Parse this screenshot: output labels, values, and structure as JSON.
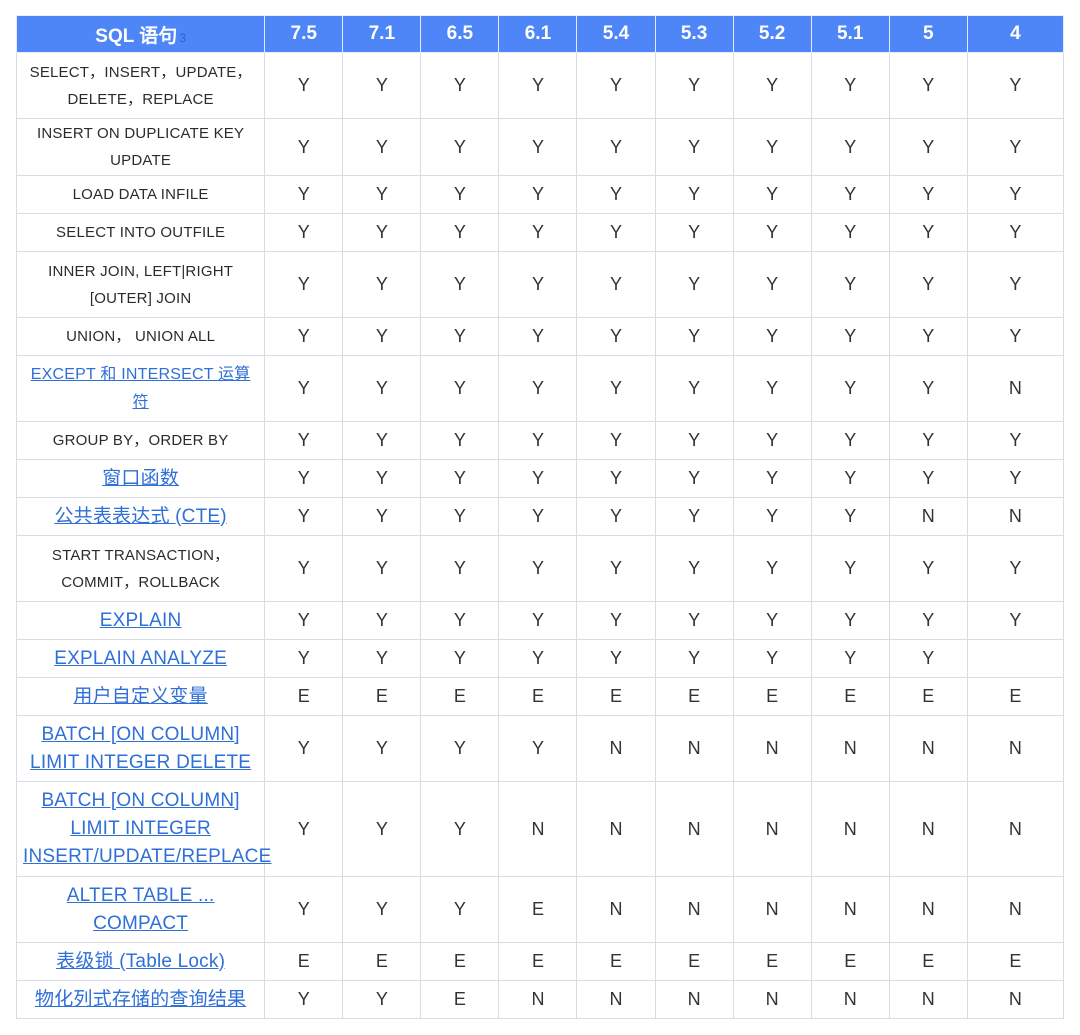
{
  "header": {
    "feature_col": "SQL 语句",
    "feature_col_note": "3",
    "versions": [
      "7.5",
      "7.1",
      "6.5",
      "6.1",
      "5.4",
      "5.3",
      "5.2",
      "5.1",
      "5",
      "4"
    ]
  },
  "rows": [
    {
      "label": "SELECT，INSERT，UPDATE，DELETE，REPLACE",
      "link": false,
      "values": [
        "Y",
        "Y",
        "Y",
        "Y",
        "Y",
        "Y",
        "Y",
        "Y",
        "Y",
        "Y"
      ]
    },
    {
      "label": "INSERT ON DUPLICATE KEY UPDATE",
      "link": false,
      "values": [
        "Y",
        "Y",
        "Y",
        "Y",
        "Y",
        "Y",
        "Y",
        "Y",
        "Y",
        "Y"
      ]
    },
    {
      "label": "LOAD DATA INFILE",
      "link": false,
      "values": [
        "Y",
        "Y",
        "Y",
        "Y",
        "Y",
        "Y",
        "Y",
        "Y",
        "Y",
        "Y"
      ]
    },
    {
      "label": "SELECT INTO OUTFILE",
      "link": false,
      "values": [
        "Y",
        "Y",
        "Y",
        "Y",
        "Y",
        "Y",
        "Y",
        "Y",
        "Y",
        "Y"
      ]
    },
    {
      "label": "INNER JOIN, LEFT|RIGHT [OUTER] JOIN",
      "link": false,
      "values": [
        "Y",
        "Y",
        "Y",
        "Y",
        "Y",
        "Y",
        "Y",
        "Y",
        "Y",
        "Y"
      ]
    },
    {
      "label": "UNION， UNION ALL",
      "link": false,
      "values": [
        "Y",
        "Y",
        "Y",
        "Y",
        "Y",
        "Y",
        "Y",
        "Y",
        "Y",
        "Y"
      ]
    },
    {
      "label": "EXCEPT 和 INTERSECT 运算符",
      "link": true,
      "small": true,
      "values": [
        "Y",
        "Y",
        "Y",
        "Y",
        "Y",
        "Y",
        "Y",
        "Y",
        "Y",
        "N"
      ]
    },
    {
      "label": "GROUP BY，ORDER BY",
      "link": false,
      "values": [
        "Y",
        "Y",
        "Y",
        "Y",
        "Y",
        "Y",
        "Y",
        "Y",
        "Y",
        "Y"
      ]
    },
    {
      "label": "窗口函数",
      "link": true,
      "values": [
        "Y",
        "Y",
        "Y",
        "Y",
        "Y",
        "Y",
        "Y",
        "Y",
        "Y",
        "Y"
      ]
    },
    {
      "label": "公共表表达式 (CTE)",
      "link": true,
      "values": [
        "Y",
        "Y",
        "Y",
        "Y",
        "Y",
        "Y",
        "Y",
        "Y",
        "N",
        "N"
      ]
    },
    {
      "label": "START TRANSACTION，COMMIT，ROLLBACK",
      "link": false,
      "values": [
        "Y",
        "Y",
        "Y",
        "Y",
        "Y",
        "Y",
        "Y",
        "Y",
        "Y",
        "Y"
      ]
    },
    {
      "label": "EXPLAIN",
      "link": true,
      "values": [
        "Y",
        "Y",
        "Y",
        "Y",
        "Y",
        "Y",
        "Y",
        "Y",
        "Y",
        "Y"
      ]
    },
    {
      "label": "EXPLAIN ANALYZE",
      "link": true,
      "values": [
        "Y",
        "Y",
        "Y",
        "Y",
        "Y",
        "Y",
        "Y",
        "Y",
        "Y",
        ""
      ]
    },
    {
      "label": "用户自定义变量",
      "link": true,
      "values": [
        "E",
        "E",
        "E",
        "E",
        "E",
        "E",
        "E",
        "E",
        "E",
        "E"
      ]
    },
    {
      "label": "BATCH [ON COLUMN] LIMIT INTEGER DELETE",
      "link": true,
      "values": [
        "Y",
        "Y",
        "Y",
        "Y",
        "N",
        "N",
        "N",
        "N",
        "N",
        "N"
      ]
    },
    {
      "label": "BATCH [ON COLUMN] LIMIT INTEGER INSERT/UPDATE/REPLACE",
      "link": true,
      "values": [
        "Y",
        "Y",
        "Y",
        "N",
        "N",
        "N",
        "N",
        "N",
        "N",
        "N"
      ]
    },
    {
      "label": "ALTER TABLE ... COMPACT",
      "link": true,
      "values": [
        "Y",
        "Y",
        "Y",
        "E",
        "N",
        "N",
        "N",
        "N",
        "N",
        "N"
      ]
    },
    {
      "label": "表级锁 (Table Lock)",
      "link": true,
      "values": [
        "E",
        "E",
        "E",
        "E",
        "E",
        "E",
        "E",
        "E",
        "E",
        "E"
      ]
    },
    {
      "label": "物化列式存储的查询结果",
      "link": true,
      "values": [
        "Y",
        "Y",
        "E",
        "N",
        "N",
        "N",
        "N",
        "N",
        "N",
        "N"
      ]
    }
  ]
}
